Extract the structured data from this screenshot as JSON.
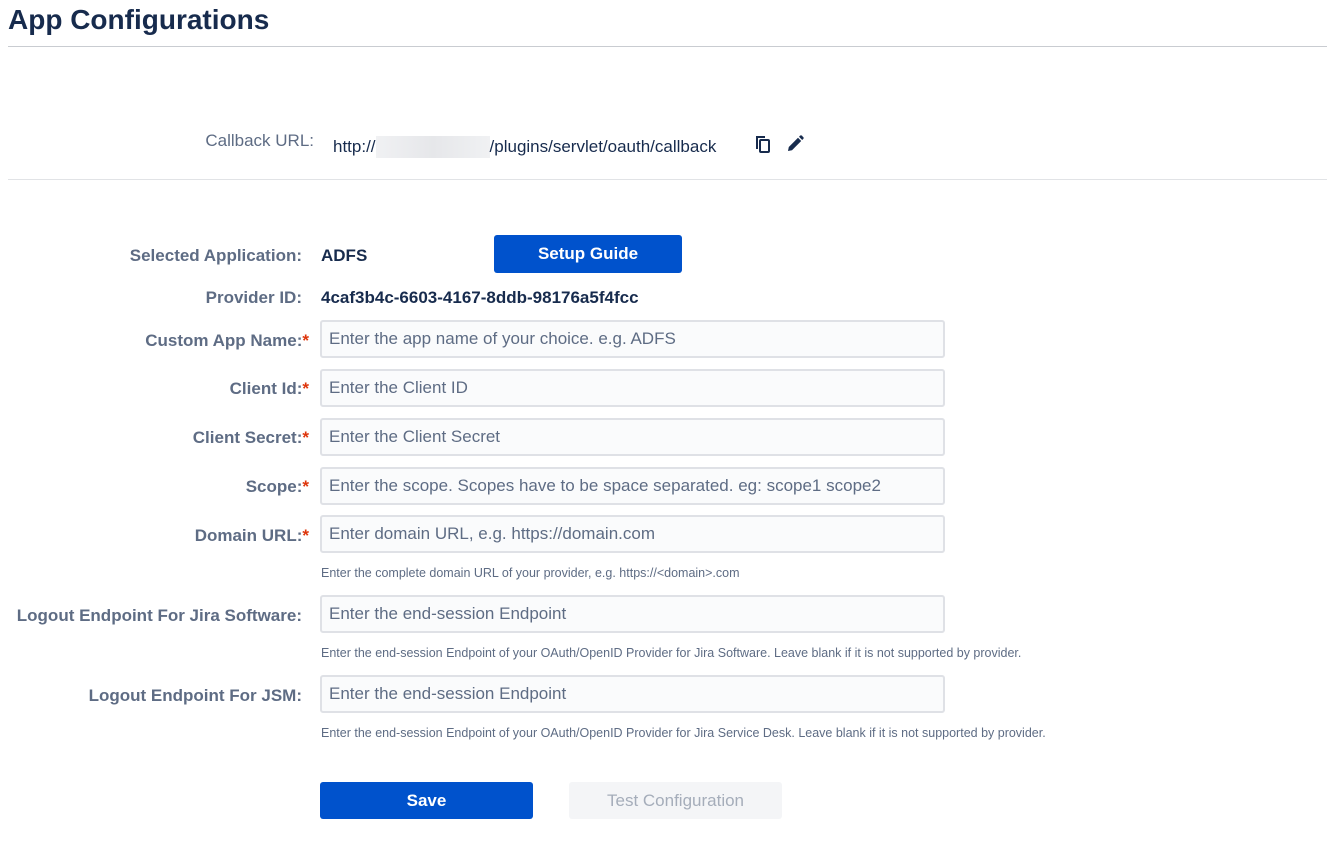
{
  "page": {
    "title": "App Configurations"
  },
  "callback": {
    "label": "Callback URL:",
    "url_prefix": "http://",
    "url_suffix": "/plugins/servlet/oauth/callback",
    "copy_icon": "copy-icon",
    "edit_icon": "pencil-icon"
  },
  "form": {
    "selected_application": {
      "label": "Selected Application:",
      "value": "ADFS"
    },
    "setup_guide_label": "Setup Guide",
    "provider_id": {
      "label": "Provider ID:",
      "value": "4caf3b4c-6603-4167-8ddb-98176a5f4fcc"
    },
    "custom_app_name": {
      "label": "Custom App Name:",
      "required_mark": "*",
      "placeholder": "Enter the app name of your choice. e.g. ADFS",
      "value": ""
    },
    "client_id": {
      "label": "Client Id:",
      "required_mark": "*",
      "placeholder": "Enter the Client ID",
      "value": ""
    },
    "client_secret": {
      "label": "Client Secret:",
      "required_mark": "*",
      "placeholder": "Enter the Client Secret",
      "value": ""
    },
    "scope": {
      "label": "Scope:",
      "required_mark": "*",
      "placeholder": "Enter the scope. Scopes have to be space separated. eg: scope1 scope2",
      "value": ""
    },
    "domain_url": {
      "label": "Domain URL:",
      "required_mark": "*",
      "placeholder": "Enter domain URL, e.g. https://domain.com",
      "value": "",
      "help": "Enter the complete domain URL of your provider, e.g. https://<domain>.com"
    },
    "logout_jira_software": {
      "label": "Logout Endpoint For Jira Software:",
      "placeholder": "Enter the end-session Endpoint",
      "value": "",
      "help": "Enter the end-session Endpoint of your OAuth/OpenID Provider for Jira Software. Leave blank if it is not supported by provider."
    },
    "logout_jsm": {
      "label": "Logout Endpoint For JSM:",
      "placeholder": "Enter the end-session Endpoint",
      "value": "",
      "help": "Enter the end-session Endpoint of your OAuth/OpenID Provider for Jira Service Desk. Leave blank if it is not supported by provider."
    }
  },
  "actions": {
    "save_label": "Save",
    "test_label": "Test Configuration"
  },
  "colors": {
    "primary": "#0052cc",
    "required": "#de350b",
    "heading": "#172b4d",
    "muted": "#5e6c84",
    "disabled_bg": "#f4f5f7",
    "disabled_text": "#a5adba"
  }
}
